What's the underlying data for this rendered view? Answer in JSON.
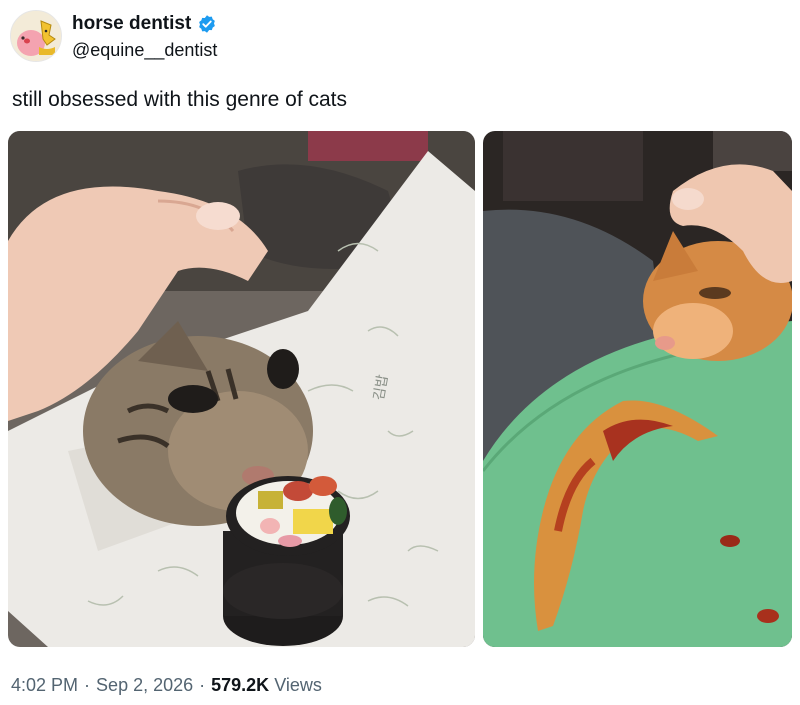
{
  "user": {
    "display_name": "horse dentist",
    "handle": "@equine__dentist",
    "verified": true,
    "verified_color": "#1d9bf0"
  },
  "tweet": {
    "text": "still obsessed with this genre of cats"
  },
  "media": [
    {
      "description_icon": "cat-with-kimbap-photo"
    },
    {
      "description_icon": "cat-with-pizza-photo"
    }
  ],
  "footer": {
    "time": "4:02 PM",
    "date": "Sep 2, 2026",
    "views_count": "579.2K",
    "views_label": "Views",
    "separator": "·"
  },
  "colors": {
    "text_primary": "#0f1419",
    "text_secondary": "#536471",
    "plate_green": "#6fc08e"
  }
}
